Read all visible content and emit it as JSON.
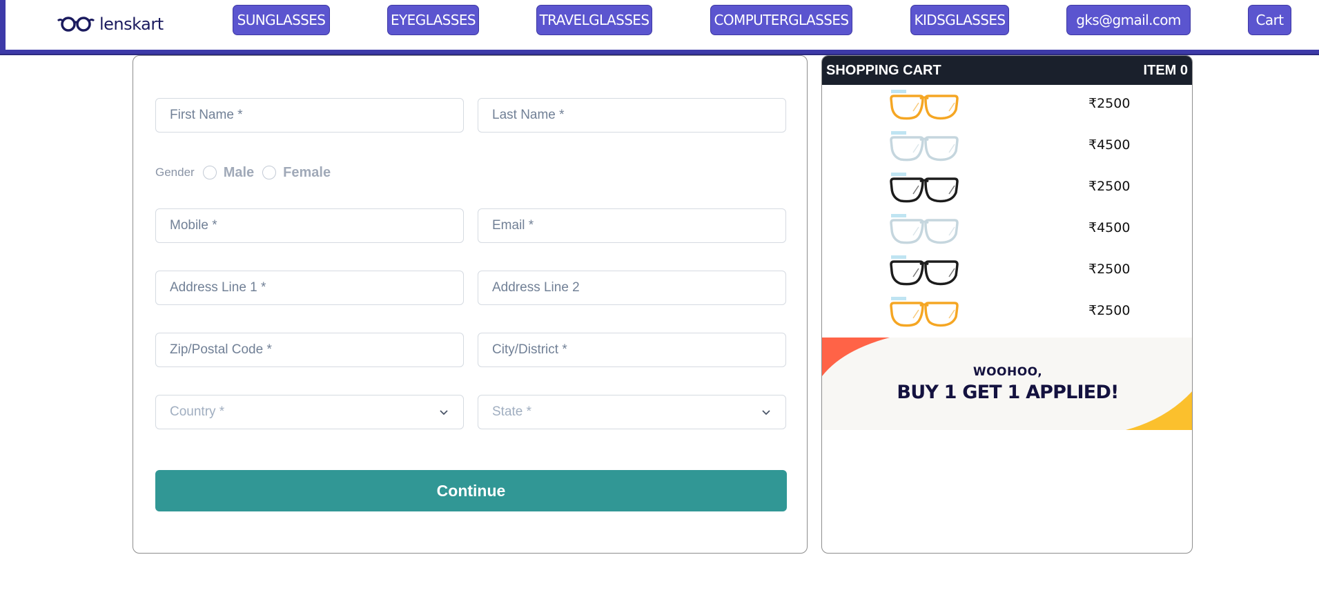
{
  "brand": {
    "name": "lenskart"
  },
  "nav": {
    "items": [
      "SUNGLASSES",
      "EYEGLASSES",
      "TRAVELGLASSES",
      "COMPUTERGLASSES",
      "KIDSGLASSES",
      "gks@gmail.com",
      "Cart"
    ]
  },
  "form": {
    "first_name_placeholder": "First Name *",
    "last_name_placeholder": "Last Name *",
    "gender_label": "Gender",
    "gender_male": "Male",
    "gender_female": "Female",
    "mobile_placeholder": "Mobile *",
    "email_placeholder": "Email *",
    "address1_placeholder": "Address Line 1 *",
    "address2_placeholder": "Address Line 2",
    "zip_placeholder": "Zip/Postal Code *",
    "city_placeholder": "City/District *",
    "country_placeholder": "Country *",
    "state_placeholder": "State *",
    "continue_label": "Continue"
  },
  "cart": {
    "title": "SHOPPING CART",
    "item_count": "ITEM 0",
    "items": [
      {
        "price": "₹2500",
        "frame_color": "#f5a623"
      },
      {
        "price": "₹4500",
        "frame_color": "#c5d6de"
      },
      {
        "price": "₹2500",
        "frame_color": "#1c1c1c"
      },
      {
        "price": "₹4500",
        "frame_color": "#c5d6de"
      },
      {
        "price": "₹2500",
        "frame_color": "#1c1c1c"
      },
      {
        "price": "₹2500",
        "frame_color": "#f5a623"
      }
    ],
    "promo": {
      "line1": "WOOHOO,",
      "line2": "BUY 1 GET 1 APPLIED!"
    }
  },
  "colors": {
    "nav_button": "#5b55cf",
    "nav_border": "#3d3aa8",
    "continue_button": "#319795",
    "cart_header": "#1a202c",
    "promo_red": "#ff6347",
    "promo_yellow": "#fbc02d"
  }
}
